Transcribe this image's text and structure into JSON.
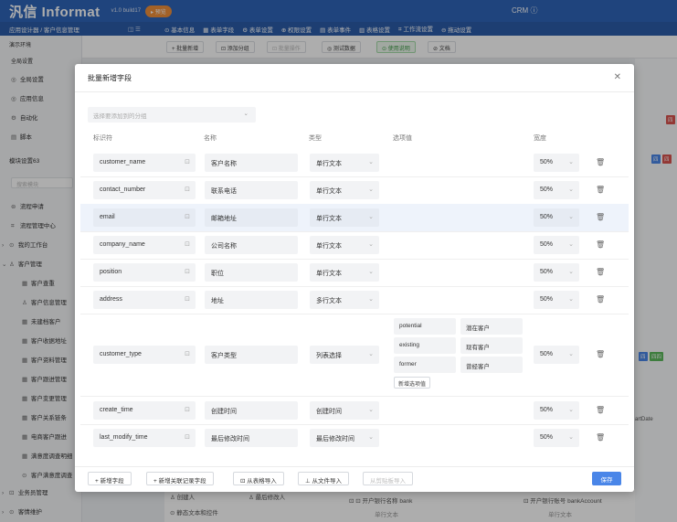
{
  "app": {
    "title": "汎信 Informat",
    "version": "v1.0 build17",
    "badge": "▸ 预览",
    "crm_label": "CRM ⓘ"
  },
  "nav": {
    "breadcrumb": "应用设计器 / 客户信息管理",
    "tabs": [
      "基本信息",
      "表单字段",
      "表单设置",
      "权限设置",
      "表单事件",
      "表格设置",
      "工作流设置",
      "拖动设置"
    ]
  },
  "sidebar": {
    "env": "演示环境",
    "global_section": "全局设置",
    "items": [
      {
        "icon": "◎",
        "label": "全局设置"
      },
      {
        "icon": "◎",
        "label": "应用信息"
      },
      {
        "icon": "⚙",
        "label": "自动化"
      },
      {
        "icon": "▤",
        "label": "脚本"
      }
    ],
    "module_label": "模块设置63",
    "search_placeholder": "搜索模块",
    "modules": [
      "流程申请",
      "流程管理中心",
      "我的工作台",
      "客户管理",
      "客户查重",
      "客户信息管理",
      "未建档客户",
      "客户收据地址",
      "客户资料管理",
      "客户跟进管理",
      "客户变更管理",
      "客户关系链条",
      "电商客户跟进",
      "满意度调查明细",
      "客户满意度调查",
      "业务员管理",
      "客情维护"
    ]
  },
  "toolbar": {
    "buttons": [
      "+ 批量新增",
      "⊡ 添加分组",
      "⊡ 批量操作",
      "◎ 测试数据",
      "⊙ 使用说明",
      "⊘ 文档"
    ]
  },
  "background_bottom": {
    "creator": "创建人",
    "modifier": "最后修改人",
    "static_text": "静态文本和控件",
    "bank_label": "开户银行名称",
    "bank_code": "bank",
    "bank_account_label": "开户银行账号",
    "bank_account_code": "bankAccount",
    "field_type": "单行文本",
    "partial_code": "artDate"
  },
  "modal": {
    "title": "批量新增字段",
    "group_placeholder": "选择要添加到的分组",
    "columns": {
      "identifier": "标识符",
      "name": "名称",
      "type": "类型",
      "options": "选项值",
      "width": "宽度"
    },
    "rows": [
      {
        "id": "customer_name",
        "name": "客户名称",
        "type": "单行文本",
        "width": "50%"
      },
      {
        "id": "contact_number",
        "name": "联系电话",
        "type": "单行文本",
        "width": "50%"
      },
      {
        "id": "email",
        "name": "邮箱地址",
        "type": "单行文本",
        "width": "50%"
      },
      {
        "id": "company_name",
        "name": "公司名称",
        "type": "单行文本",
        "width": "50%"
      },
      {
        "id": "position",
        "name": "职位",
        "type": "单行文本",
        "width": "50%"
      },
      {
        "id": "address",
        "name": "地址",
        "type": "多行文本",
        "width": "50%"
      },
      {
        "id": "customer_type",
        "name": "客户类型",
        "type": "列表选择",
        "width": "50%",
        "options": [
          {
            "value": "potential",
            "label": "潜在客户"
          },
          {
            "value": "existing",
            "label": "现有客户"
          },
          {
            "value": "former",
            "label": "曾经客户"
          }
        ],
        "add_option": "新增选项值"
      },
      {
        "id": "create_time",
        "name": "创建时间",
        "type": "创建时间",
        "width": "50%"
      },
      {
        "id": "last_modify_time",
        "name": "最后修改时间",
        "type": "最后修改时间",
        "width": "50%"
      }
    ],
    "footer": {
      "add_field": "+ 新增字段",
      "add_related": "+ 新增关联记录字段",
      "from_table": "⊡ 从表格导入",
      "from_file": "⊥ 从文件导入",
      "from_clipboard": "从剪贴板导入",
      "save": "保存"
    }
  }
}
